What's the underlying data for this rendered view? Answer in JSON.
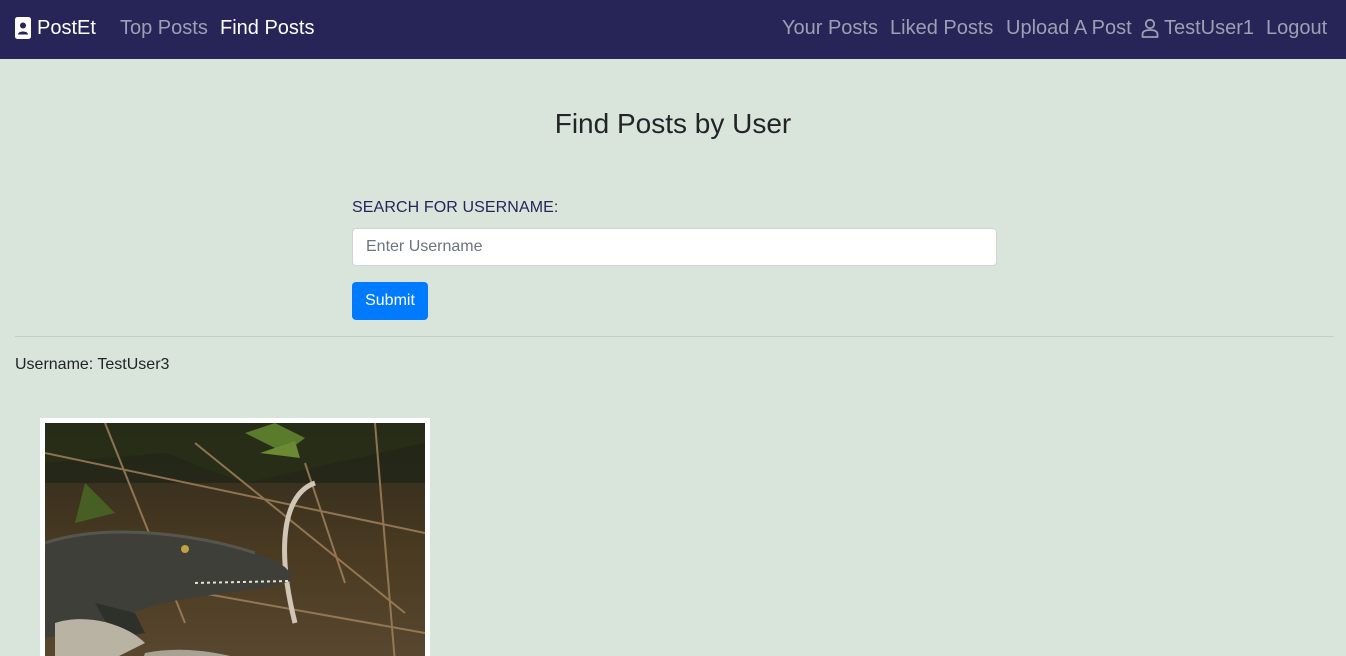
{
  "navbar": {
    "brand": "PostEt",
    "links": [
      {
        "label": "Top Posts",
        "active": false
      },
      {
        "label": "Find Posts",
        "active": true
      }
    ],
    "right_links": {
      "your_posts": "Your Posts",
      "liked_posts": "Liked Posts",
      "upload": "Upload A Post",
      "user": "TestUser1",
      "logout": "Logout"
    }
  },
  "main": {
    "title": "Find Posts by User",
    "search": {
      "label": "SEARCH FOR USERNAME:",
      "placeholder": "Enter Username",
      "value": "",
      "submit_label": "Submit"
    },
    "result": {
      "username_line": "Username: TestUser3"
    }
  },
  "colors": {
    "navbar_bg": "#272458",
    "page_bg": "#d9e5da",
    "primary": "#007bff"
  }
}
